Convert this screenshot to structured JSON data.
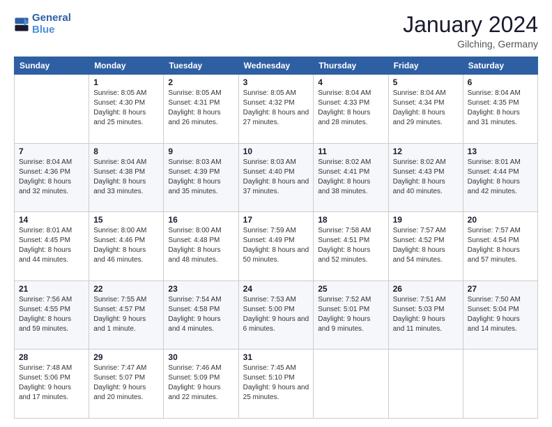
{
  "header": {
    "logo_line1": "General",
    "logo_line2": "Blue",
    "month_title": "January 2024",
    "location": "Gilching, Germany"
  },
  "columns": [
    "Sunday",
    "Monday",
    "Tuesday",
    "Wednesday",
    "Thursday",
    "Friday",
    "Saturday"
  ],
  "weeks": [
    [
      {
        "day": "",
        "sunrise": "",
        "sunset": "",
        "daylight": ""
      },
      {
        "day": "1",
        "sunrise": "Sunrise: 8:05 AM",
        "sunset": "Sunset: 4:30 PM",
        "daylight": "Daylight: 8 hours and 25 minutes."
      },
      {
        "day": "2",
        "sunrise": "Sunrise: 8:05 AM",
        "sunset": "Sunset: 4:31 PM",
        "daylight": "Daylight: 8 hours and 26 minutes."
      },
      {
        "day": "3",
        "sunrise": "Sunrise: 8:05 AM",
        "sunset": "Sunset: 4:32 PM",
        "daylight": "Daylight: 8 hours and 27 minutes."
      },
      {
        "day": "4",
        "sunrise": "Sunrise: 8:04 AM",
        "sunset": "Sunset: 4:33 PM",
        "daylight": "Daylight: 8 hours and 28 minutes."
      },
      {
        "day": "5",
        "sunrise": "Sunrise: 8:04 AM",
        "sunset": "Sunset: 4:34 PM",
        "daylight": "Daylight: 8 hours and 29 minutes."
      },
      {
        "day": "6",
        "sunrise": "Sunrise: 8:04 AM",
        "sunset": "Sunset: 4:35 PM",
        "daylight": "Daylight: 8 hours and 31 minutes."
      }
    ],
    [
      {
        "day": "7",
        "sunrise": "Sunrise: 8:04 AM",
        "sunset": "Sunset: 4:36 PM",
        "daylight": "Daylight: 8 hours and 32 minutes."
      },
      {
        "day": "8",
        "sunrise": "Sunrise: 8:04 AM",
        "sunset": "Sunset: 4:38 PM",
        "daylight": "Daylight: 8 hours and 33 minutes."
      },
      {
        "day": "9",
        "sunrise": "Sunrise: 8:03 AM",
        "sunset": "Sunset: 4:39 PM",
        "daylight": "Daylight: 8 hours and 35 minutes."
      },
      {
        "day": "10",
        "sunrise": "Sunrise: 8:03 AM",
        "sunset": "Sunset: 4:40 PM",
        "daylight": "Daylight: 8 hours and 37 minutes."
      },
      {
        "day": "11",
        "sunrise": "Sunrise: 8:02 AM",
        "sunset": "Sunset: 4:41 PM",
        "daylight": "Daylight: 8 hours and 38 minutes."
      },
      {
        "day": "12",
        "sunrise": "Sunrise: 8:02 AM",
        "sunset": "Sunset: 4:43 PM",
        "daylight": "Daylight: 8 hours and 40 minutes."
      },
      {
        "day": "13",
        "sunrise": "Sunrise: 8:01 AM",
        "sunset": "Sunset: 4:44 PM",
        "daylight": "Daylight: 8 hours and 42 minutes."
      }
    ],
    [
      {
        "day": "14",
        "sunrise": "Sunrise: 8:01 AM",
        "sunset": "Sunset: 4:45 PM",
        "daylight": "Daylight: 8 hours and 44 minutes."
      },
      {
        "day": "15",
        "sunrise": "Sunrise: 8:00 AM",
        "sunset": "Sunset: 4:46 PM",
        "daylight": "Daylight: 8 hours and 46 minutes."
      },
      {
        "day": "16",
        "sunrise": "Sunrise: 8:00 AM",
        "sunset": "Sunset: 4:48 PM",
        "daylight": "Daylight: 8 hours and 48 minutes."
      },
      {
        "day": "17",
        "sunrise": "Sunrise: 7:59 AM",
        "sunset": "Sunset: 4:49 PM",
        "daylight": "Daylight: 8 hours and 50 minutes."
      },
      {
        "day": "18",
        "sunrise": "Sunrise: 7:58 AM",
        "sunset": "Sunset: 4:51 PM",
        "daylight": "Daylight: 8 hours and 52 minutes."
      },
      {
        "day": "19",
        "sunrise": "Sunrise: 7:57 AM",
        "sunset": "Sunset: 4:52 PM",
        "daylight": "Daylight: 8 hours and 54 minutes."
      },
      {
        "day": "20",
        "sunrise": "Sunrise: 7:57 AM",
        "sunset": "Sunset: 4:54 PM",
        "daylight": "Daylight: 8 hours and 57 minutes."
      }
    ],
    [
      {
        "day": "21",
        "sunrise": "Sunrise: 7:56 AM",
        "sunset": "Sunset: 4:55 PM",
        "daylight": "Daylight: 8 hours and 59 minutes."
      },
      {
        "day": "22",
        "sunrise": "Sunrise: 7:55 AM",
        "sunset": "Sunset: 4:57 PM",
        "daylight": "Daylight: 9 hours and 1 minute."
      },
      {
        "day": "23",
        "sunrise": "Sunrise: 7:54 AM",
        "sunset": "Sunset: 4:58 PM",
        "daylight": "Daylight: 9 hours and 4 minutes."
      },
      {
        "day": "24",
        "sunrise": "Sunrise: 7:53 AM",
        "sunset": "Sunset: 5:00 PM",
        "daylight": "Daylight: 9 hours and 6 minutes."
      },
      {
        "day": "25",
        "sunrise": "Sunrise: 7:52 AM",
        "sunset": "Sunset: 5:01 PM",
        "daylight": "Daylight: 9 hours and 9 minutes."
      },
      {
        "day": "26",
        "sunrise": "Sunrise: 7:51 AM",
        "sunset": "Sunset: 5:03 PM",
        "daylight": "Daylight: 9 hours and 11 minutes."
      },
      {
        "day": "27",
        "sunrise": "Sunrise: 7:50 AM",
        "sunset": "Sunset: 5:04 PM",
        "daylight": "Daylight: 9 hours and 14 minutes."
      }
    ],
    [
      {
        "day": "28",
        "sunrise": "Sunrise: 7:48 AM",
        "sunset": "Sunset: 5:06 PM",
        "daylight": "Daylight: 9 hours and 17 minutes."
      },
      {
        "day": "29",
        "sunrise": "Sunrise: 7:47 AM",
        "sunset": "Sunset: 5:07 PM",
        "daylight": "Daylight: 9 hours and 20 minutes."
      },
      {
        "day": "30",
        "sunrise": "Sunrise: 7:46 AM",
        "sunset": "Sunset: 5:09 PM",
        "daylight": "Daylight: 9 hours and 22 minutes."
      },
      {
        "day": "31",
        "sunrise": "Sunrise: 7:45 AM",
        "sunset": "Sunset: 5:10 PM",
        "daylight": "Daylight: 9 hours and 25 minutes."
      },
      {
        "day": "",
        "sunrise": "",
        "sunset": "",
        "daylight": ""
      },
      {
        "day": "",
        "sunrise": "",
        "sunset": "",
        "daylight": ""
      },
      {
        "day": "",
        "sunrise": "",
        "sunset": "",
        "daylight": ""
      }
    ]
  ]
}
